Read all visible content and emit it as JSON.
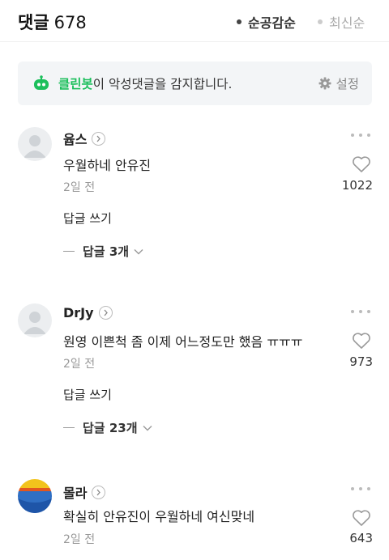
{
  "header": {
    "title": "댓글",
    "count": "678",
    "sort_good": "순공감순",
    "sort_new": "최신순"
  },
  "cleanbot": {
    "brand": "클린봇",
    "message": "이 악성댓글을 감지합니다.",
    "settings_label": "설정",
    "brand_color": "#1cbf5c"
  },
  "comments": [
    {
      "nickname": "윱스",
      "text": "우월하네 안유진",
      "date": "2일 전",
      "likes": "1022",
      "reply_write": "답글 쓰기",
      "replies_label": "답글 3개",
      "avatar": "default"
    },
    {
      "nickname": "DrJy",
      "text": "원영 이쁜척 좀 이제 어느정도만 했음 ㅠㅠㅠ",
      "date": "2일 전",
      "likes": "973",
      "reply_write": "답글 쓰기",
      "replies_label": "답글 23개",
      "avatar": "default"
    },
    {
      "nickname": "몰라",
      "text": "확실히 안유진이 우월하네 여신맞네",
      "date": "2일 전",
      "likes": "643",
      "avatar": "custom"
    }
  ]
}
